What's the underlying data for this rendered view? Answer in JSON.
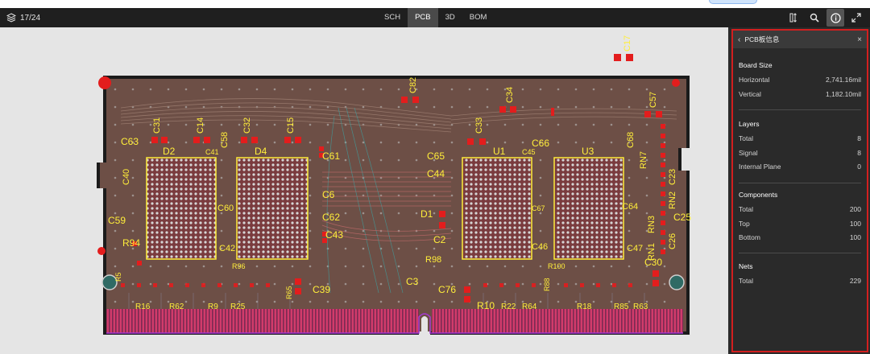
{
  "toolbar": {
    "page_counter": "17/24",
    "tabs": [
      {
        "label": "SCH",
        "active": false
      },
      {
        "label": "PCB",
        "active": true
      },
      {
        "label": "3D",
        "active": false
      },
      {
        "label": "BOM",
        "active": false
      }
    ],
    "tool_icons": [
      "measure-icon",
      "search-icon",
      "info-icon",
      "expand-icon"
    ]
  },
  "panel": {
    "title": "PCB板信息",
    "board_size": {
      "heading": "Board Size",
      "rows": [
        {
          "label": "Horizontal",
          "value": "2,741.16mil"
        },
        {
          "label": "Vertical",
          "value": "1,182.10mil"
        }
      ]
    },
    "layers": {
      "heading": "Layers",
      "rows": [
        {
          "label": "Total",
          "value": "8"
        },
        {
          "label": "Signal",
          "value": "8"
        },
        {
          "label": "Internal Plane",
          "value": "0"
        }
      ]
    },
    "components": {
      "heading": "Components",
      "rows": [
        {
          "label": "Total",
          "value": "200"
        },
        {
          "label": "Top",
          "value": "100"
        },
        {
          "label": "Bottom",
          "value": "100"
        }
      ]
    },
    "nets": {
      "heading": "Nets",
      "rows": [
        {
          "label": "Total",
          "value": "229"
        }
      ]
    }
  },
  "pcb": {
    "chips": [
      {
        "ref": "D2"
      },
      {
        "ref": "D4"
      },
      {
        "ref": "U1"
      },
      {
        "ref": "U3"
      }
    ],
    "labels": [
      "C63",
      "C31",
      "C14",
      "C58",
      "C32",
      "C15",
      "C41",
      "C61",
      "C40",
      "C59",
      "R94",
      "C60",
      "C6",
      "C62",
      "C43",
      "C42",
      "C39",
      "C65",
      "C66",
      "C45",
      "C44",
      "D1",
      "C2",
      "R98",
      "C67",
      "C46",
      "C68",
      "C57",
      "C23",
      "RN7",
      "RN2",
      "RN3",
      "RN1",
      "C25",
      "C26",
      "C47",
      "C30",
      "C64",
      "C17",
      "C82",
      "C34",
      "C33",
      "C3",
      "C76",
      "R16",
      "R62",
      "R25",
      "R10",
      "R22",
      "R18",
      "R85",
      "R63",
      "R100",
      "R96",
      "R65",
      "R88",
      "R64",
      "R9",
      "R5"
    ]
  },
  "colors": {
    "accent_red": "#d21f1f",
    "silkscreen": "#ffee3a",
    "pad_red": "#e31d1d",
    "board": "#6d4f46",
    "finger": "#c8356a"
  }
}
